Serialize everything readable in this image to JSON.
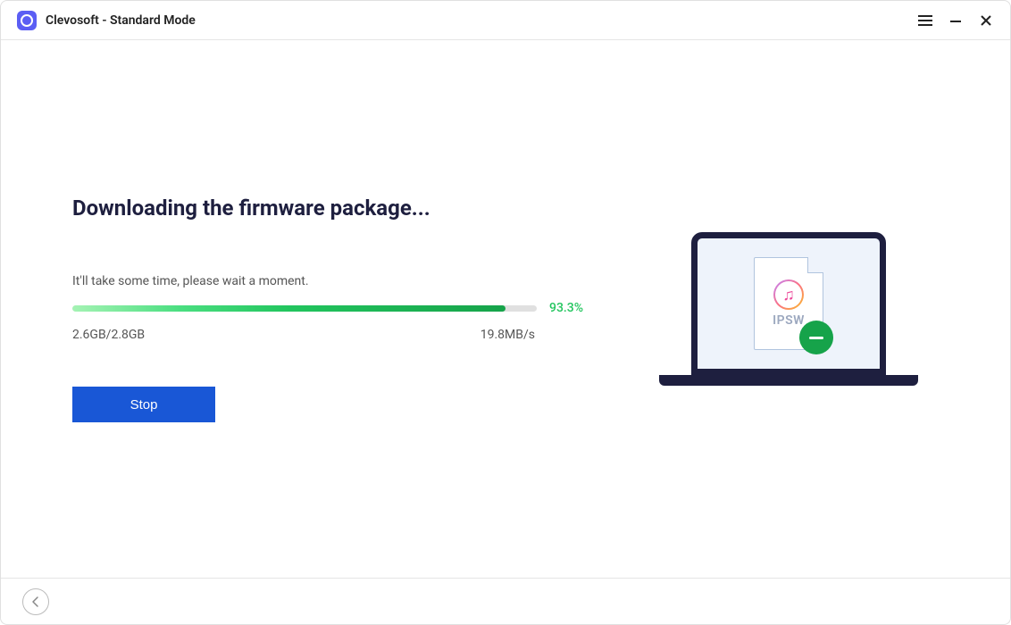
{
  "header": {
    "title": "Clevosoft - Standard Mode"
  },
  "main": {
    "heading": "Downloading the firmware package...",
    "subtext": "It'll take some time, please wait a moment.",
    "progress_percent": "93.3%",
    "progress_value": 93.3,
    "downloaded_size": "2.6GB/2.8GB",
    "download_speed": "19.8MB/s",
    "stop_label": "Stop"
  },
  "illustration": {
    "doc_label": "IPSW"
  }
}
